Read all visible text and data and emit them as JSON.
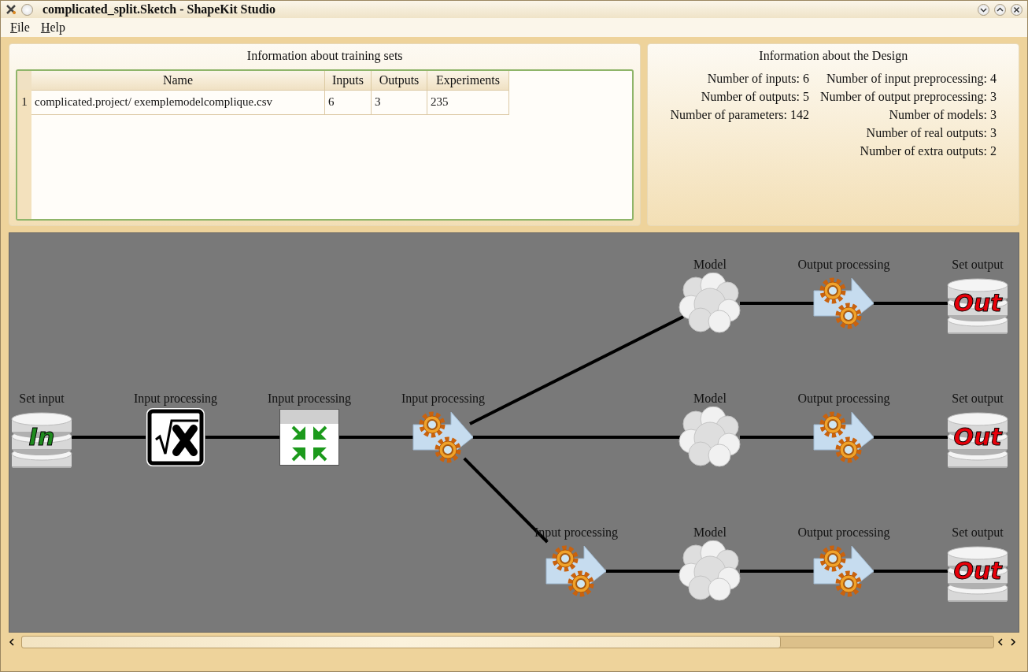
{
  "window": {
    "title": "complicated_split.Sketch - ShapeKit Studio"
  },
  "menu": [
    "File",
    "Help"
  ],
  "training_sets": {
    "title": "Information about training sets",
    "columns": [
      "Name",
      "Inputs",
      "Outputs",
      "Experiments"
    ],
    "rows": [
      {
        "number": "1",
        "cells": [
          "complicated.project/ exemplemodelcomplique.csv",
          "6",
          "3",
          "235"
        ]
      }
    ]
  },
  "design_info": {
    "title": "Information about the Design",
    "left": [
      "Number of inputs: 6",
      "Number of outputs: 5",
      "Number of parameters: 142"
    ],
    "right": [
      "Number of input preprocessing: 4",
      "Number of output preprocessing: 3",
      "Number of models: 3",
      "Number of real outputs: 3",
      "Number of extra outputs: 2"
    ]
  },
  "diagram": {
    "nodes": [
      {
        "label": "Model",
        "kind": "cloud"
      },
      {
        "label": "Output processing",
        "kind": "gears"
      },
      {
        "label": "Set output",
        "kind": "database-out",
        "icon_text": "Out"
      },
      {
        "label": "Set input",
        "kind": "database-in",
        "icon_text": "In"
      },
      {
        "label": "Input processing",
        "kind": "sqrt"
      },
      {
        "label": "Input processing",
        "kind": "compress"
      },
      {
        "label": "Input processing",
        "kind": "gears"
      },
      {
        "label": "Model",
        "kind": "cloud"
      },
      {
        "label": "Output processing",
        "kind": "gears"
      },
      {
        "label": "Set output",
        "kind": "database-out",
        "icon_text": "Out"
      },
      {
        "label": "Input processing",
        "kind": "gears"
      },
      {
        "label": "Model",
        "kind": "cloud"
      },
      {
        "label": "Output processing",
        "kind": "gears"
      },
      {
        "label": "Set output",
        "kind": "database-out",
        "icon_text": "Out"
      }
    ]
  }
}
